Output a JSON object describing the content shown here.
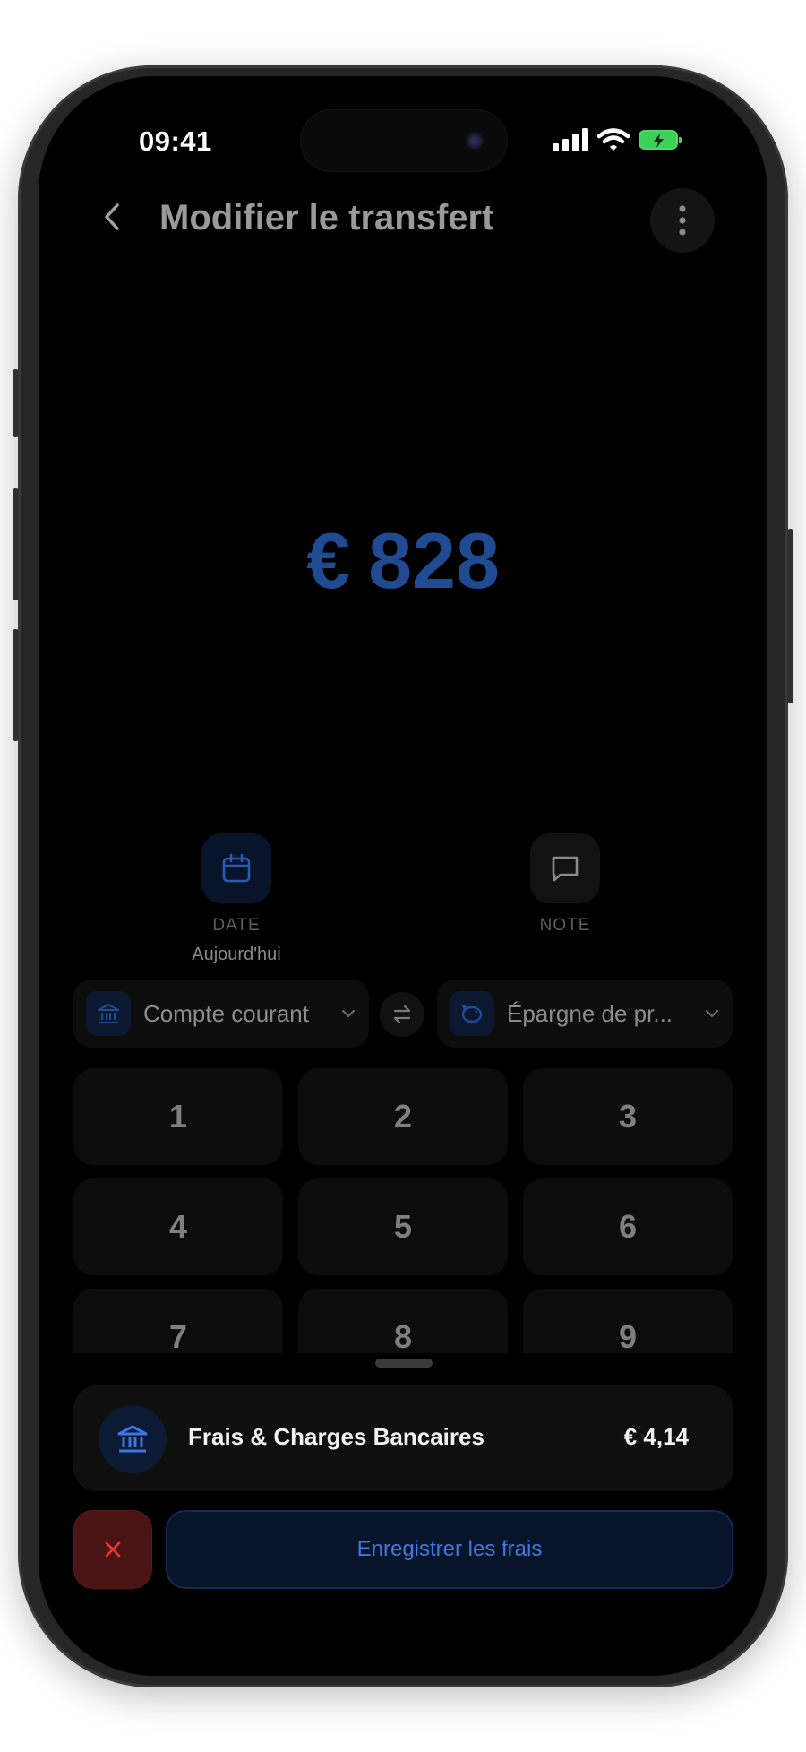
{
  "status": {
    "time": "09:41"
  },
  "header": {
    "title": "Modifier le transfert"
  },
  "amount": {
    "currency": "€",
    "value": "828"
  },
  "actions": {
    "date": {
      "label": "DATE",
      "value": "Aujourd'hui"
    },
    "note": {
      "label": "NOTE"
    }
  },
  "accounts": {
    "from": {
      "name": "Compte courant",
      "icon": "bank-icon"
    },
    "to": {
      "name": "Épargne de pr...",
      "icon": "piggy-bank-icon"
    }
  },
  "keypad": {
    "k1": "1",
    "k2": "2",
    "k3": "3",
    "k4": "4",
    "k5": "5",
    "k6": "6",
    "k7": "7",
    "k8": "8",
    "k9": "9"
  },
  "fee": {
    "name": "Frais & Charges Bancaires",
    "amount": "€ 4,14",
    "icon": "bank-icon"
  },
  "buttons": {
    "save_label": "Enregistrer les frais"
  },
  "colors": {
    "accent": "#3f7ae0",
    "amount": "#204a92",
    "cancel_bg": "#4a1414",
    "battery": "#4cd964"
  }
}
